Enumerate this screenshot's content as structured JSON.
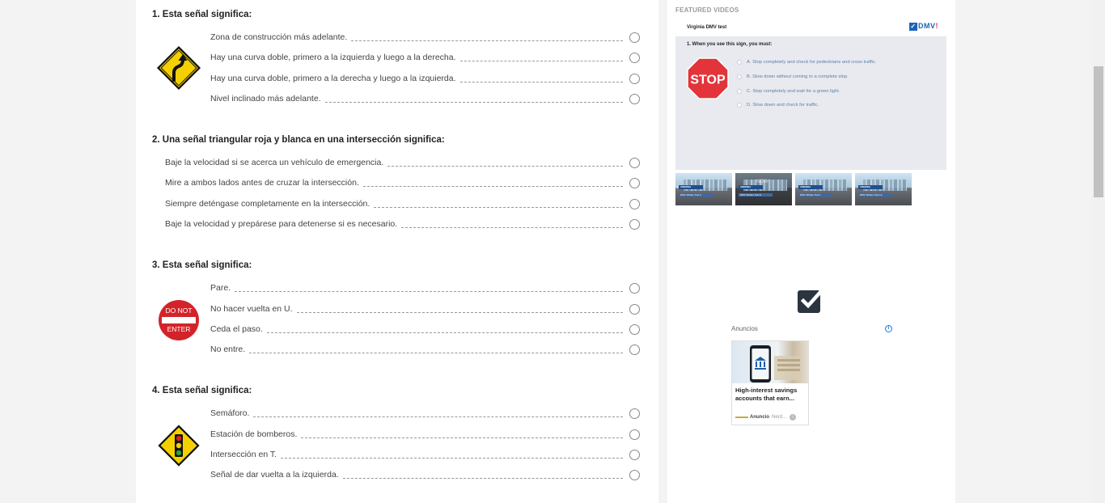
{
  "questions": [
    {
      "title": "1. Esta señal significa:",
      "options": [
        "Zona de construcción más adelante.",
        "Hay una curva doble, primero a la izquierda y luego a la derecha.",
        "Hay una curva doble, primero a la derecha y luego a la izquierda.",
        "Nivel inclinado más adelante."
      ]
    },
    {
      "title": "2. Una señal triangular roja y blanca en una intersección significa:",
      "options": [
        "Baje la velocidad si se acerca un vehículo de emergencia.",
        "Mire a ambos lados antes de cruzar la intersección.",
        "Siempre deténgase completamente en la intersección.",
        "Baje la velocidad y prepárese para detenerse si es necesario."
      ]
    },
    {
      "title": "3. Esta señal significa:",
      "sign_text": [
        "DO NOT",
        "ENTER"
      ],
      "options": [
        "Pare.",
        "No hacer vuelta en U.",
        "Ceda el paso.",
        "No entre."
      ]
    },
    {
      "title": "4. Esta señal significa:",
      "options": [
        "Semáforo.",
        "Estación de bomberos.",
        "Intersección en T.",
        "Señal de dar vuelta a la izquierda."
      ]
    }
  ],
  "sidebar": {
    "featured_label": "FEATURED VIDEOS",
    "video": {
      "title": "Virginia DMV test",
      "logo": "DMV",
      "question": "1.   When you see this sign, you must:",
      "sign_text": "STOP",
      "answers": [
        "A.  Stop completely and check for pedestrians and cross traffic.",
        "B.  Slow down without coming to a complete stop.",
        "C.  Stop completely and wait for a green light.",
        "D.  Slow down and check for traffic."
      ]
    },
    "thumbnails": [
      {
        "tag": "VIRGINIA",
        "sub": "DMV Written Test 3"
      },
      {
        "tag": "VIRGINIA",
        "sub": "DMV Written Test 8",
        "overlay": "NOW"
      },
      {
        "tag": "VIRGINIA",
        "sub": "DMV Written Test 1"
      },
      {
        "tag": "VIRGINIA",
        "sub": "DMV Written Test 14"
      }
    ],
    "ads": {
      "label": "Anuncios",
      "title": "High-interest savings accounts that earn...",
      "advertiser": "Anuncio",
      "source": "Nerd..."
    }
  },
  "colors": {
    "warning_yellow": "#f5d000",
    "red": "#d3232a",
    "stop_red": "#e2343a",
    "brand_blue": "#1a64b8"
  }
}
